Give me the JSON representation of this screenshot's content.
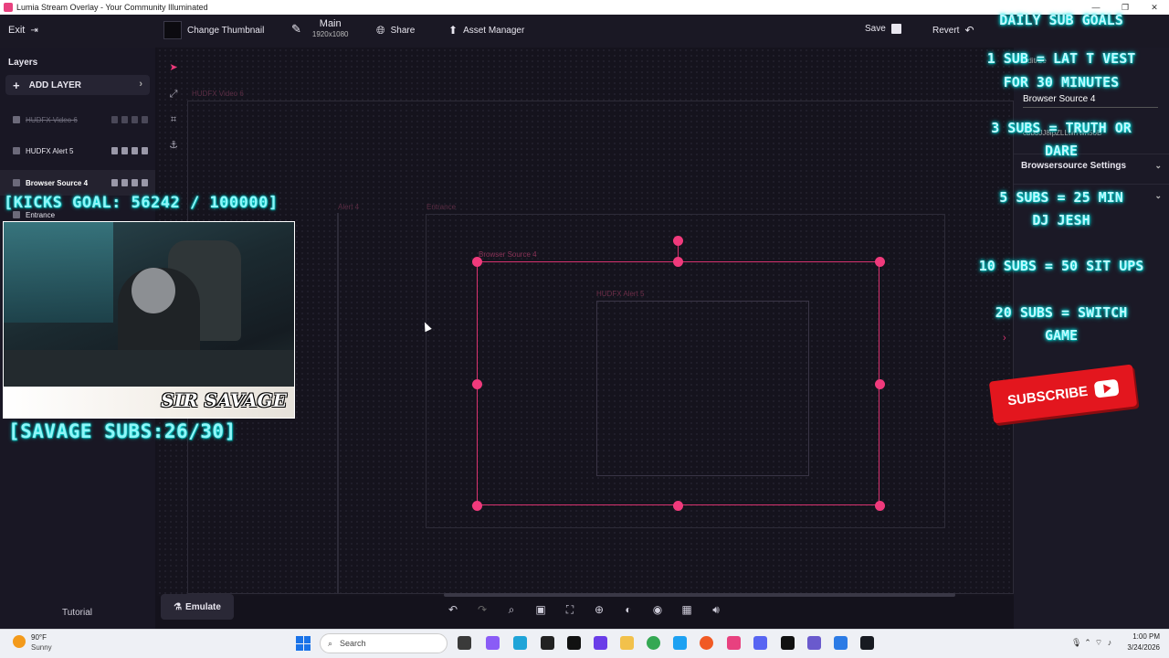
{
  "window": {
    "title": "Lumia Stream Overlay - Your Community Illuminated",
    "controls": [
      "—",
      "❐",
      "✕"
    ]
  },
  "toolbar": {
    "exit_label": "Exit",
    "change_thumbnail_label": "Change Thumbnail",
    "main_label": "Main",
    "main_resolution": "1920x1080",
    "share_label": "Share",
    "asset_manager_label": "Asset Manager",
    "save_label": "Save",
    "revert_label": "Revert"
  },
  "layers": {
    "title": "Layers",
    "add_label": "ADD LAYER",
    "items": [
      {
        "label": "HUDFX Video 6",
        "state": "hidden"
      },
      {
        "label": "HUDFX Alert 5",
        "state": "visible"
      },
      {
        "label": "Browser Source 4",
        "state": "selected"
      },
      {
        "label": "Entrance",
        "state": "visible"
      }
    ],
    "tutorial_label": "Tutorial"
  },
  "canvas": {
    "labels": {
      "hudfx_video": "HUDFX Video 6",
      "alert4": "Alert 4",
      "entrance": "Entrance",
      "browser_source": "Browser Source 4",
      "hudfx_alert": "HUDFX Alert 5"
    }
  },
  "right_panel": {
    "subtitle": "Edit/Se",
    "layer_name": "Browser Source 4",
    "layer_id": "cbb3JJ8lpZLLwi7wn5oB",
    "sections": [
      {
        "label": "Browsersource Settings"
      },
      {
        "label": ""
      }
    ]
  },
  "bottom": {
    "emulate_label": "Emulate",
    "tools": [
      "undo-icon",
      "redo-icon",
      "zoom-out-icon",
      "fit-icon",
      "frame-icon",
      "zoom-in-icon",
      "contrast-icon",
      "camera-icon",
      "grid-icon",
      "volume-icon"
    ]
  },
  "overlay": {
    "kicks_goal": "[KICKS GOAL: 56242 / 100000]",
    "savage_subs": "[SAVAGE SUBS:26/30]",
    "webcam_name": "SIR SAVAGE",
    "subscribe_label": "SUBSCRIBE",
    "goals": [
      "DAILY SUB GOALS",
      "1 SUB = LAT T VEST",
      "FOR 30 MINUTES",
      "3 SUBS = TRUTH OR",
      "DARE",
      "5 SUBS = 25 MIN",
      "DJ JESH",
      "10 SUBS = 50 SIT UPS",
      "20 SUBS = SWITCH",
      "GAME"
    ]
  },
  "taskbar": {
    "weather_temp": "90°F",
    "weather_desc": "Sunny",
    "search_placeholder": "Search",
    "time": "1:00 PM",
    "date": "3/24/2026"
  },
  "colors": {
    "accent": "#f03a7c",
    "panel": "#191724",
    "canvas": "#15131d",
    "neon": "#8ff6f8"
  }
}
